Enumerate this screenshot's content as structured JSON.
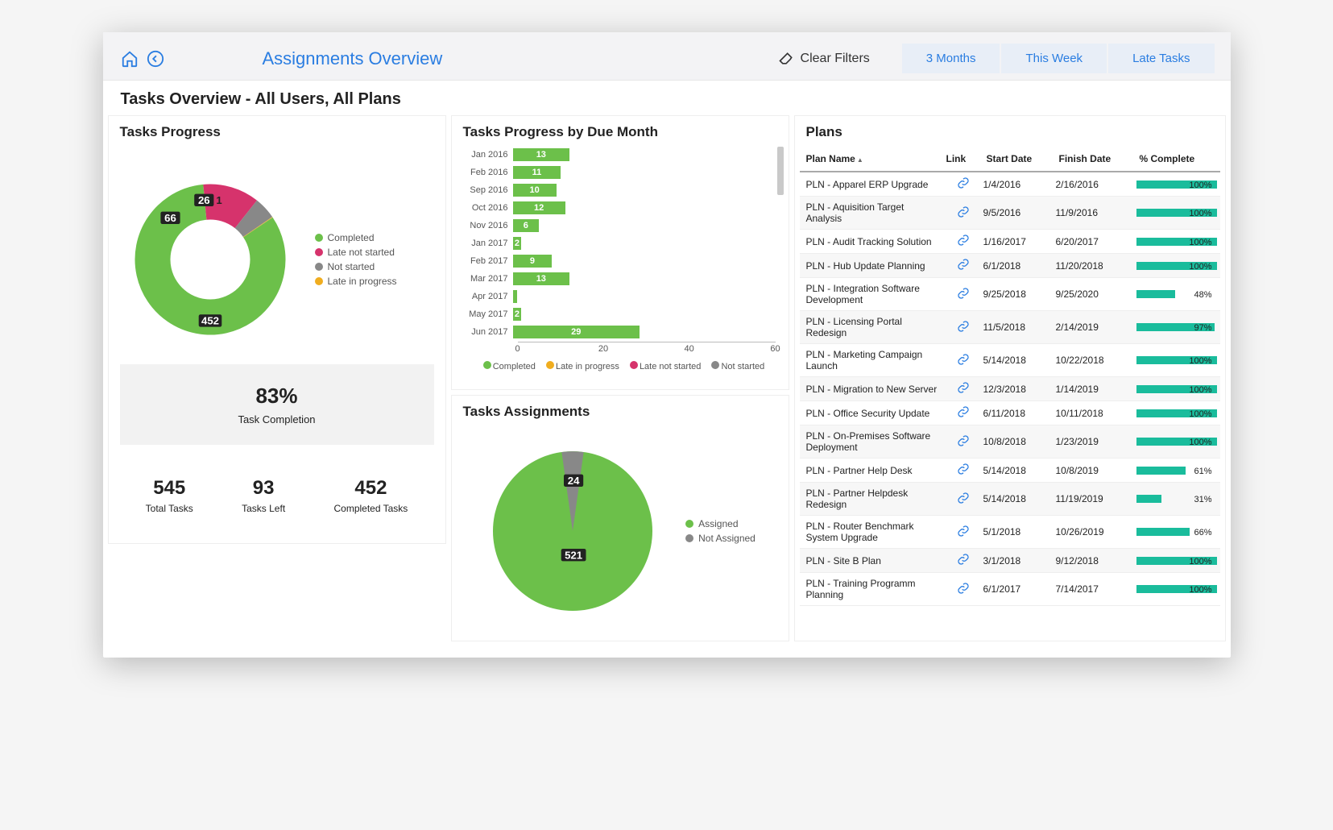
{
  "header": {
    "breadcrumb": "Assignments Overview",
    "clear_filters": "Clear Filters",
    "tabs": [
      "3 Months",
      "This Week",
      "Late Tasks"
    ]
  },
  "subtitle": "Tasks Overview - All Users, All Plans",
  "tasks_progress": {
    "title": "Tasks Progress",
    "legend": [
      {
        "name": "Completed",
        "color": "#6cc04a"
      },
      {
        "name": "Late not started",
        "color": "#d6336c"
      },
      {
        "name": "Not started",
        "color": "#888888"
      },
      {
        "name": "Late in progress",
        "color": "#f0ad1f"
      }
    ],
    "completion_pct": "83%",
    "completion_label": "Task Completion",
    "totals": [
      {
        "value": "545",
        "label": "Total Tasks"
      },
      {
        "value": "93",
        "label": "Tasks Left"
      },
      {
        "value": "452",
        "label": "Completed Tasks"
      }
    ]
  },
  "by_month": {
    "title": "Tasks Progress by Due Month",
    "axis_ticks": [
      "0",
      "20",
      "40",
      "60"
    ],
    "legend": [
      {
        "name": "Completed",
        "color": "#6cc04a"
      },
      {
        "name": "Late in progress",
        "color": "#f0ad1f"
      },
      {
        "name": "Late not started",
        "color": "#d6336c"
      },
      {
        "name": "Not started",
        "color": "#888888"
      }
    ]
  },
  "assignments": {
    "title": "Tasks Assignments",
    "legend": [
      {
        "name": "Assigned",
        "color": "#6cc04a"
      },
      {
        "name": "Not Assigned",
        "color": "#888888"
      }
    ]
  },
  "plans": {
    "title": "Plans",
    "columns": [
      "Plan Name",
      "Link",
      "Start Date",
      "Finish Date",
      "% Complete"
    ],
    "rows": [
      {
        "name": "PLN - Apparel ERP Upgrade",
        "start": "1/4/2016",
        "finish": "2/16/2016",
        "pct": 100,
        "pct_label": "100%"
      },
      {
        "name": "PLN - Aquisition Target Analysis",
        "start": "9/5/2016",
        "finish": "11/9/2016",
        "pct": 100,
        "pct_label": "100%"
      },
      {
        "name": "PLN - Audit Tracking Solution",
        "start": "1/16/2017",
        "finish": "6/20/2017",
        "pct": 100,
        "pct_label": "100%"
      },
      {
        "name": "PLN - Hub Update Planning",
        "start": "6/1/2018",
        "finish": "11/20/2018",
        "pct": 100,
        "pct_label": "100%"
      },
      {
        "name": "PLN - Integration Software Development",
        "start": "9/25/2018",
        "finish": "9/25/2020",
        "pct": 48,
        "pct_label": "48%"
      },
      {
        "name": "PLN - Licensing Portal Redesign",
        "start": "11/5/2018",
        "finish": "2/14/2019",
        "pct": 97,
        "pct_label": "97%"
      },
      {
        "name": "PLN - Marketing Campaign Launch",
        "start": "5/14/2018",
        "finish": "10/22/2018",
        "pct": 100,
        "pct_label": "100%"
      },
      {
        "name": "PLN - Migration to New Server",
        "start": "12/3/2018",
        "finish": "1/14/2019",
        "pct": 100,
        "pct_label": "100%"
      },
      {
        "name": "PLN - Office Security Update",
        "start": "6/11/2018",
        "finish": "10/11/2018",
        "pct": 100,
        "pct_label": "100%"
      },
      {
        "name": "PLN - On-Premises Software Deployment",
        "start": "10/8/2018",
        "finish": "1/23/2019",
        "pct": 100,
        "pct_label": "100%"
      },
      {
        "name": "PLN - Partner Help Desk",
        "start": "5/14/2018",
        "finish": "10/8/2019",
        "pct": 61,
        "pct_label": "61%"
      },
      {
        "name": "PLN - Partner Helpdesk Redesign",
        "start": "5/14/2018",
        "finish": "11/19/2019",
        "pct": 31,
        "pct_label": "31%"
      },
      {
        "name": "PLN - Router Benchmark System Upgrade",
        "start": "5/1/2018",
        "finish": "10/26/2019",
        "pct": 66,
        "pct_label": "66%"
      },
      {
        "name": "PLN - Site B Plan",
        "start": "3/1/2018",
        "finish": "9/12/2018",
        "pct": 100,
        "pct_label": "100%"
      },
      {
        "name": "PLN - Training Programm Planning",
        "start": "6/1/2017",
        "finish": "7/14/2017",
        "pct": 100,
        "pct_label": "100%"
      }
    ]
  },
  "chart_data": [
    {
      "type": "pie",
      "title": "Tasks Progress",
      "series": [
        {
          "name": "Completed",
          "value": 452,
          "color": "#6cc04a"
        },
        {
          "name": "Late not started",
          "value": 66,
          "color": "#d6336c"
        },
        {
          "name": "Not started",
          "value": 26,
          "color": "#888888"
        },
        {
          "name": "Late in progress",
          "value": 1,
          "color": "#f0ad1f"
        }
      ],
      "subtype": "donut"
    },
    {
      "type": "bar",
      "title": "Tasks Progress by Due Month",
      "orientation": "horizontal",
      "categories": [
        "Jan 2016",
        "Feb 2016",
        "Sep 2016",
        "Oct 2016",
        "Nov 2016",
        "Jan 2017",
        "Feb 2017",
        "Mar 2017",
        "Apr 2017",
        "May 2017",
        "Jun 2017"
      ],
      "values": [
        13,
        11,
        10,
        12,
        6,
        2,
        9,
        13,
        1,
        2,
        29
      ],
      "series_name": "Completed",
      "xlim": [
        0,
        60
      ],
      "x_ticks": [
        0,
        20,
        40,
        60
      ]
    },
    {
      "type": "pie",
      "title": "Tasks Assignments",
      "series": [
        {
          "name": "Assigned",
          "value": 521,
          "color": "#6cc04a"
        },
        {
          "name": "Not Assigned",
          "value": 24,
          "color": "#888888"
        }
      ]
    }
  ]
}
